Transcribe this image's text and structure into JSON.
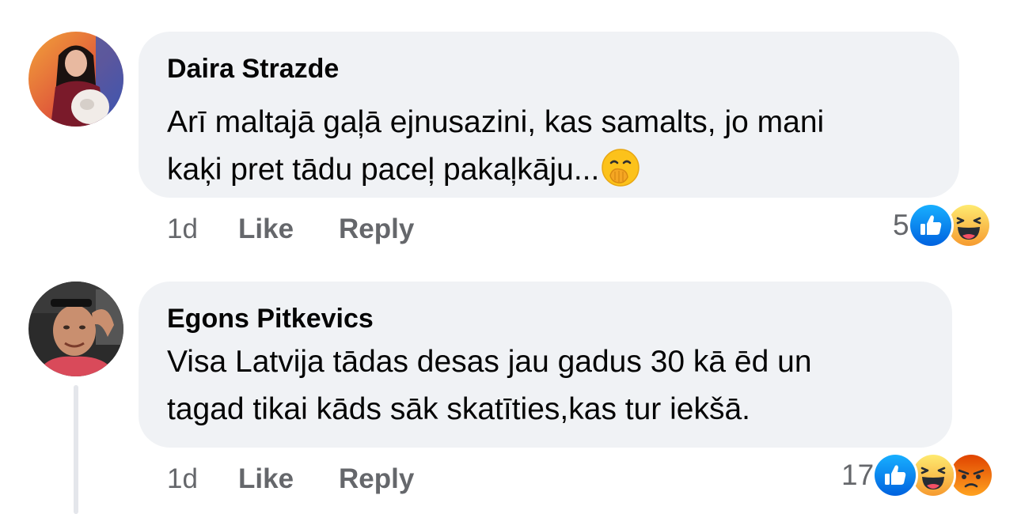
{
  "comments": [
    {
      "author": "Daira Strazde",
      "text_line1": "Arī maltajā gaļā ejnusazini, kas samalts, jo mani",
      "text_line2": "kaķi pret tādu paceļ pakaļkāju...",
      "inline_emoji": "hand-over-mouth-emoji",
      "time": "1d",
      "like_label": "Like",
      "reply_label": "Reply",
      "reaction_count": "5",
      "reactions": [
        "like",
        "haha"
      ]
    },
    {
      "author": "Egons Pitkevics",
      "text_line1": "Visa Latvija tādas desas jau gadus 30 kā ēd un",
      "text_line2": "tagad tikai kāds sāk skatīties,kas tur iekšā.",
      "time": "1d",
      "like_label": "Like",
      "reply_label": "Reply",
      "reaction_count": "17",
      "reactions": [
        "like",
        "haha",
        "angry"
      ]
    }
  ],
  "colors": {
    "bubble": "#f0f2f5",
    "meta_text": "#65676b",
    "like_blue": "#1877f2",
    "haha_yellow": "#f7b125",
    "angry_orange": "#e9710f"
  }
}
